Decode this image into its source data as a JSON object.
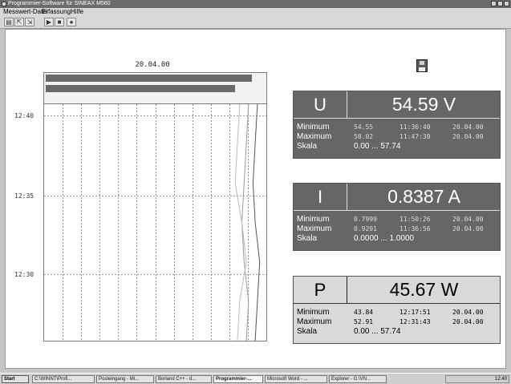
{
  "window": {
    "title": "Programmier-Software für SINEAX M560"
  },
  "menu": {
    "items": [
      "Messwert-Datei",
      "Erfassung",
      "Hilfe"
    ]
  },
  "toolbar": {
    "icons": [
      "open-icon",
      "export-icon",
      "import-icon",
      "play-icon",
      "stop-icon",
      "record-icon"
    ]
  },
  "chart": {
    "date": "20.04.00",
    "time_labels": [
      "12:40",
      "12:35",
      "12:30"
    ]
  },
  "chart_data": {
    "type": "line",
    "title": "20.04.00",
    "ytick_labels": [
      "12:40",
      "12:35",
      "12:30"
    ],
    "grid": true,
    "series": [
      {
        "values": [
          0.96,
          0.95,
          0.94,
          0.95,
          0.97,
          0.96,
          0.95
        ]
      },
      {
        "values": [
          0.92,
          0.91,
          0.9,
          0.89,
          0.9,
          0.92,
          0.91
        ]
      },
      {
        "values": [
          0.88,
          0.87,
          0.86,
          0.89,
          0.91,
          0.88,
          0.87
        ]
      }
    ],
    "bars": [
      0.95,
      0.87
    ]
  },
  "panels": [
    {
      "symbol": "U",
      "value": "54.59",
      "unit": "V",
      "style": "dark",
      "min_label": "Minimum",
      "min_value": "54.55",
      "min_time": "11:36:40",
      "min_date": "20.04.00",
      "max_label": "Maximum",
      "max_value": "58.02",
      "max_time": "11:47:30",
      "max_date": "20.04.00",
      "scale_label": "Skala",
      "scale": "0.00 ... 57.74"
    },
    {
      "symbol": "I",
      "value": "0.8387",
      "unit": "A",
      "style": "dark",
      "min_label": "Minimum",
      "min_value": "0.7999",
      "min_time": "11:50:26",
      "min_date": "20.04.00",
      "max_label": "Maximum",
      "max_value": "0.9201",
      "max_time": "11:36:56",
      "max_date": "20.04.00",
      "scale_label": "Skala",
      "scale": "0.0000 ... 1.0000"
    },
    {
      "symbol": "P",
      "value": "45.67",
      "unit": "W",
      "style": "light",
      "min_label": "Minimum",
      "min_value": "43.84",
      "min_time": "12:17:51",
      "min_date": "20.04.00",
      "max_label": "Maximum",
      "max_value": "52.91",
      "max_time": "12:31:43",
      "max_date": "20.04.00",
      "scale_label": "Skala",
      "scale": "0.00 ... 57.74"
    }
  ],
  "taskbar": {
    "start": "Start",
    "tasks": [
      "C:\\WINNT\\Profi...",
      "Posteingang - Mi...",
      "Borland C++ - d...",
      "Programmier-...",
      "Microsoft Word - ...",
      "Explorer - G:\\VN..."
    ],
    "active_index": 3,
    "clock": "12:40"
  },
  "colors": {
    "panel_dark": "#666666",
    "panel_light": "#d9d9d9",
    "titlebar": "#6b6b6b"
  }
}
